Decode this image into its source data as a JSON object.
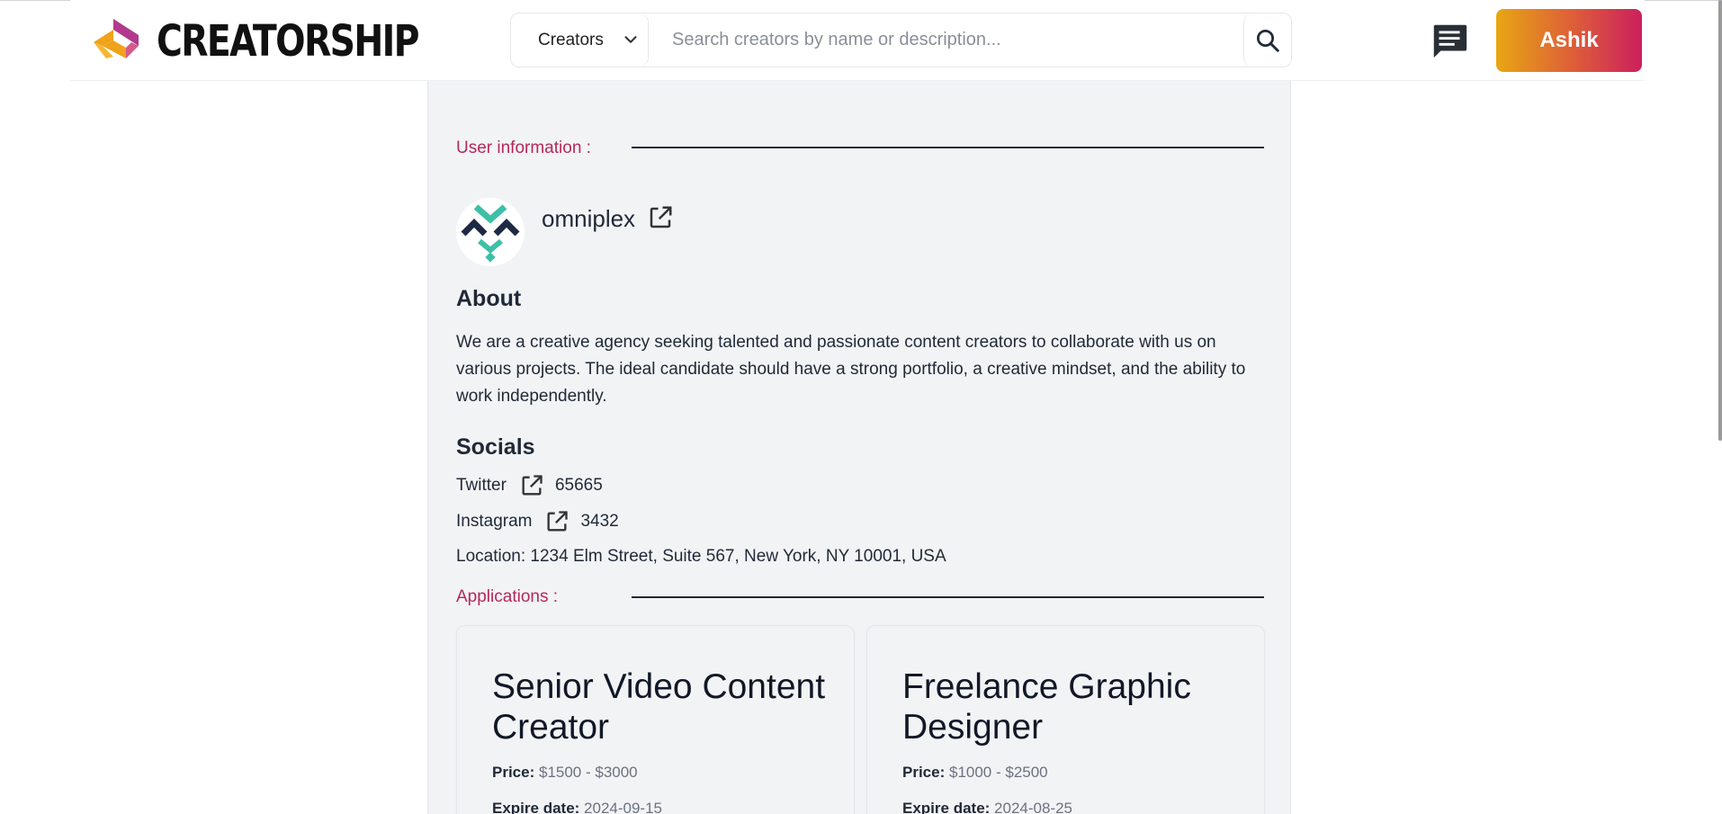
{
  "header": {
    "logo_text": "CREATORSHIP",
    "category_select": "Creators",
    "search_placeholder": "Search creators by name or description...",
    "user_button": "Ashik"
  },
  "profile": {
    "user_info_label": "User information :",
    "username": "omniplex",
    "about_heading": "About",
    "about_text": "We are a creative agency seeking talented and passionate content creators to collaborate with us on various projects. The ideal candidate should have a strong portfolio, a creative mindset, and the ability to work independently.",
    "socials_heading": "Socials",
    "socials": [
      {
        "name": "Twitter",
        "count": "65665"
      },
      {
        "name": "Instagram",
        "count": "3432"
      }
    ],
    "location": "Location: 1234 Elm Street, Suite 567, New York, NY 10001, USA",
    "applications_label": "Applications :"
  },
  "applications": [
    {
      "title": "Senior Video Content Creator",
      "price_label": "Price:",
      "price": "$1500 - $3000",
      "expire_label": "Expire date:",
      "expire": "2024-09-15"
    },
    {
      "title": "Freelance Graphic Designer",
      "price_label": "Price:",
      "price": "$1000 - $2500",
      "expire_label": "Expire date:",
      "expire": "2024-08-25"
    }
  ],
  "colors": {
    "accent": "#b5285a",
    "button_gradient_start": "#e8a613",
    "button_gradient_end": "#cc1f5e",
    "panel_bg": "#f2f3f5"
  },
  "icons": {
    "logo": "creatorship-logo-icon",
    "chevron": "chevron-down-icon",
    "search": "search-icon",
    "messages": "message-icon",
    "external_link": "external-link-icon"
  }
}
